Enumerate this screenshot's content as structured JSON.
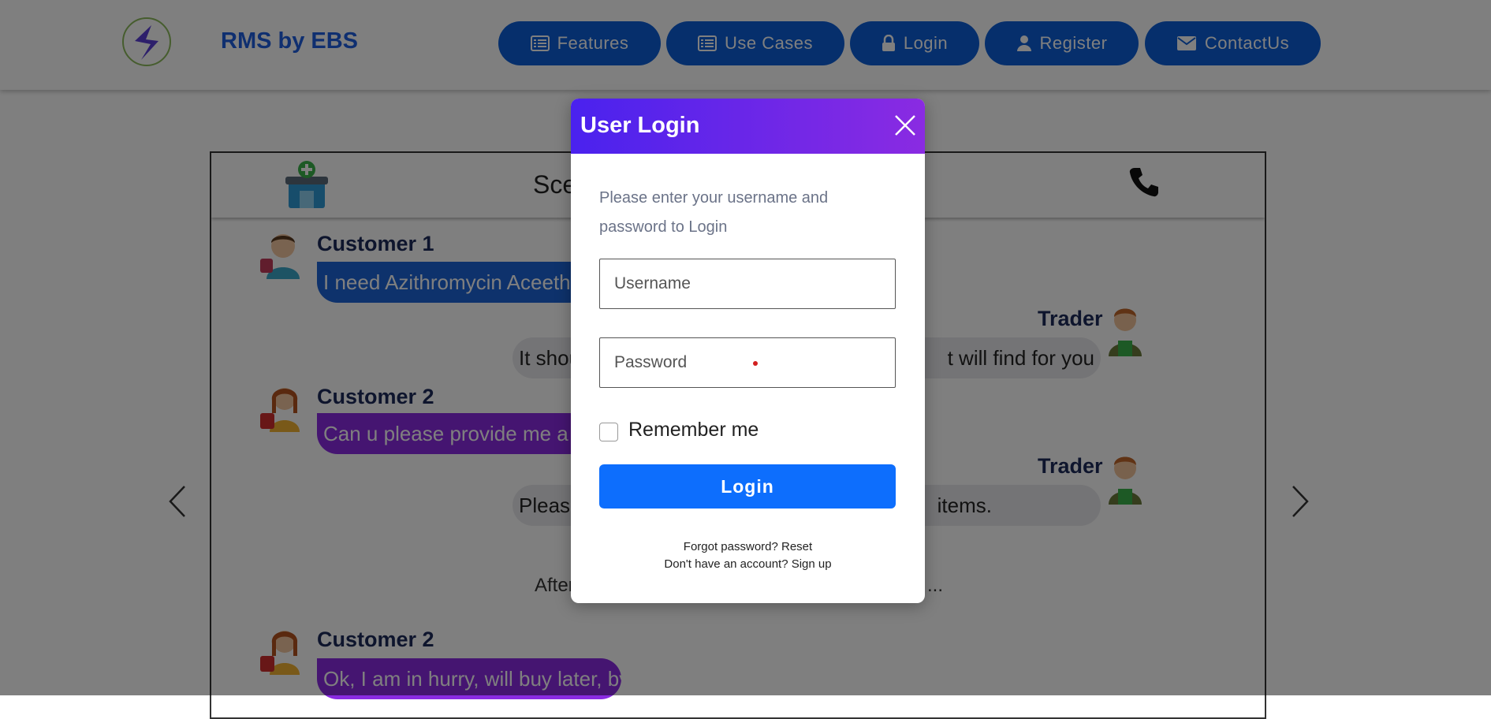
{
  "header": {
    "brand": "RMS by EBS",
    "nav": [
      {
        "label": "Features",
        "icon": "list-icon"
      },
      {
        "label": "Use Cases",
        "icon": "list-icon"
      },
      {
        "label": "Login",
        "icon": "lock-icon"
      },
      {
        "label": "Register",
        "icon": "user-icon"
      },
      {
        "label": "ContactUs",
        "icon": "envelope-icon"
      }
    ]
  },
  "scene": {
    "title": "Sce",
    "messages": [
      {
        "speaker": "Customer 1",
        "text": "I need Azithromycin Aceeth"
      },
      {
        "speaker": "Trader",
        "text_left": "It shou",
        "text_right": "t will find for you"
      },
      {
        "speaker": "Customer 2",
        "text": "Can u please provide me a she"
      },
      {
        "speaker": "Trader",
        "text_left": "Please",
        "text_right": "items."
      },
      {
        "note_left": "After",
        "note_right": "..."
      },
      {
        "speaker": "Customer 2",
        "text": "Ok, I am in hurry, will buy later, bye"
      }
    ]
  },
  "modal": {
    "title": "User Login",
    "prompt": "Please enter your username and password to Login",
    "username_placeholder": "Username",
    "password_placeholder": "Password",
    "remember_label": "Remember me",
    "login_label": "Login",
    "forgot_text": "Forgot password? Reset",
    "signup_text": "Don't have an account? Sign up"
  },
  "colors": {
    "nav_bg": "#0c5fd9",
    "brand": "#1f5fe0",
    "modal_head_start": "#4a22ee",
    "modal_head_end": "#8a2be2",
    "login_button": "#0d6efd"
  }
}
